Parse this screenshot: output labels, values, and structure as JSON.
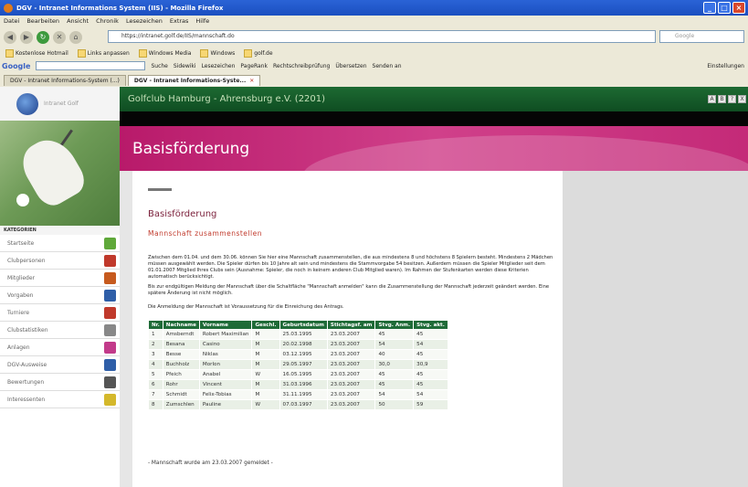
{
  "browser": {
    "title": "DGV - Intranet Informations System (IIS) - Mozilla Firefox",
    "menu": [
      "Datei",
      "Bearbeiten",
      "Ansicht",
      "Chronik",
      "Lesezeichen",
      "Extras",
      "Hilfe"
    ],
    "url": "https://intranet.golf.de/IIS/mannschaft.do",
    "search_placeholder": "Google",
    "bookmarks": [
      "Kostenlose Hotmail",
      "Links anpassen",
      "Windows Media",
      "Windows",
      "golf.de"
    ],
    "google_label": "Google",
    "google_tools": [
      "Suche",
      "Sidewiki",
      "Lesezeichen",
      "PageRank",
      "Rechtschreibprüfung",
      "Übersetzen",
      "Senden an"
    ],
    "settings_label": "Einstellungen",
    "tabs": [
      {
        "label": "DGV - Intranet Informations-System (...)"
      },
      {
        "label": "DGV - Intranet Informations-Syste..."
      }
    ]
  },
  "site": {
    "logo_text": "Intranet Golf",
    "header_title": "Golfclub Hamburg - Ahrensburg e.V. (2201)",
    "header_icons": [
      "A",
      "B",
      "?",
      "X"
    ],
    "section_heading": "Basisförderung",
    "category_label": "KATEGORIEN"
  },
  "sidebar": {
    "items": [
      {
        "label": "Startseite",
        "color": "#5fa83a"
      },
      {
        "label": "Clubpersonen",
        "color": "#c0392b"
      },
      {
        "label": "Mitglieder",
        "color": "#c65a1e"
      },
      {
        "label": "Vorgaben",
        "color": "#2e5ea8"
      },
      {
        "label": "Turniere",
        "color": "#c0392b"
      },
      {
        "label": "Clubstatistiken",
        "color": "#888888"
      },
      {
        "label": "Anlagen",
        "color": "#c23a8a"
      },
      {
        "label": "DGV-Ausweise",
        "color": "#2e5ea8"
      },
      {
        "label": "Bewertungen",
        "color": "#555555"
      },
      {
        "label": "Interessenten",
        "color": "#d4b82b"
      }
    ]
  },
  "content": {
    "title": "Basisförderung",
    "subtitle": "Mannschaft zusammenstellen",
    "para1": "Zwischen dem 01.04. und dem 30.06. können Sie hier eine Mannschaft zusammenstellen, die aus mindestens 8 und höchstens 8 Spielern besteht. Mindestens 2 Mädchen müssen ausgewählt werden. Die Spieler dürfen bis 10 Jahre alt sein und mindestens die Stammvorgabe 54 besitzen. Außerdem müssen die Spieler Mitglieder seit dem 01.01.2007 Mitglied Ihres Clubs sein (Ausnahme: Spieler, die noch in keinem anderen Club Mitglied waren). Im Rahmen der Stufenkarten werden diese Kriterien automatisch berücksichtigt.",
    "para2": "Bis zur endgültigen Meldung der Mannschaft über die Schaltfläche \"Mannschaft anmelden\" kann die Zusammenstellung der Mannschaft jederzeit geändert werden. Eine spätere Änderung ist nicht möglich.",
    "para3": "Die Anmeldung der Mannschaft ist Voraussetzung für die Einreichung des Antrags.",
    "columns": [
      "Nr.",
      "Nachname",
      "Vorname",
      "Geschl.",
      "Geburtsdatum",
      "Stichtagsf. am",
      "Stvg. Anm.",
      "Stvg. akt."
    ],
    "rows": [
      [
        "1",
        "Amsberndt",
        "Robert Maximilian",
        "M",
        "25.03.1995",
        "23.03.2007",
        "45",
        "45"
      ],
      [
        "2",
        "Besana",
        "Casino",
        "M",
        "20.02.1998",
        "23.03.2007",
        "54",
        "54"
      ],
      [
        "3",
        "Besse",
        "Niklas",
        "M",
        "03.12.1995",
        "23.03.2007",
        "40",
        "45"
      ],
      [
        "4",
        "Buchholz",
        "Morlon",
        "M",
        "29.05.1997",
        "23.03.2007",
        "30,0",
        "30,9"
      ],
      [
        "5",
        "Pfeich",
        "Anabel",
        "W",
        "16.05.1995",
        "23.03.2007",
        "45",
        "45"
      ],
      [
        "6",
        "Rohr",
        "Vincent",
        "M",
        "31.03.1996",
        "23.03.2007",
        "45",
        "45"
      ],
      [
        "7",
        "Schmidt",
        "Felix-Tobias",
        "M",
        "31.11.1995",
        "23.03.2007",
        "54",
        "54"
      ],
      [
        "8",
        "Zumschlen",
        "Pauline",
        "W",
        "07.03.1997",
        "23.03.2007",
        "50",
        "59"
      ]
    ],
    "note": "- Mannschaft wurde am 23.03.2007 gemeldet -"
  }
}
